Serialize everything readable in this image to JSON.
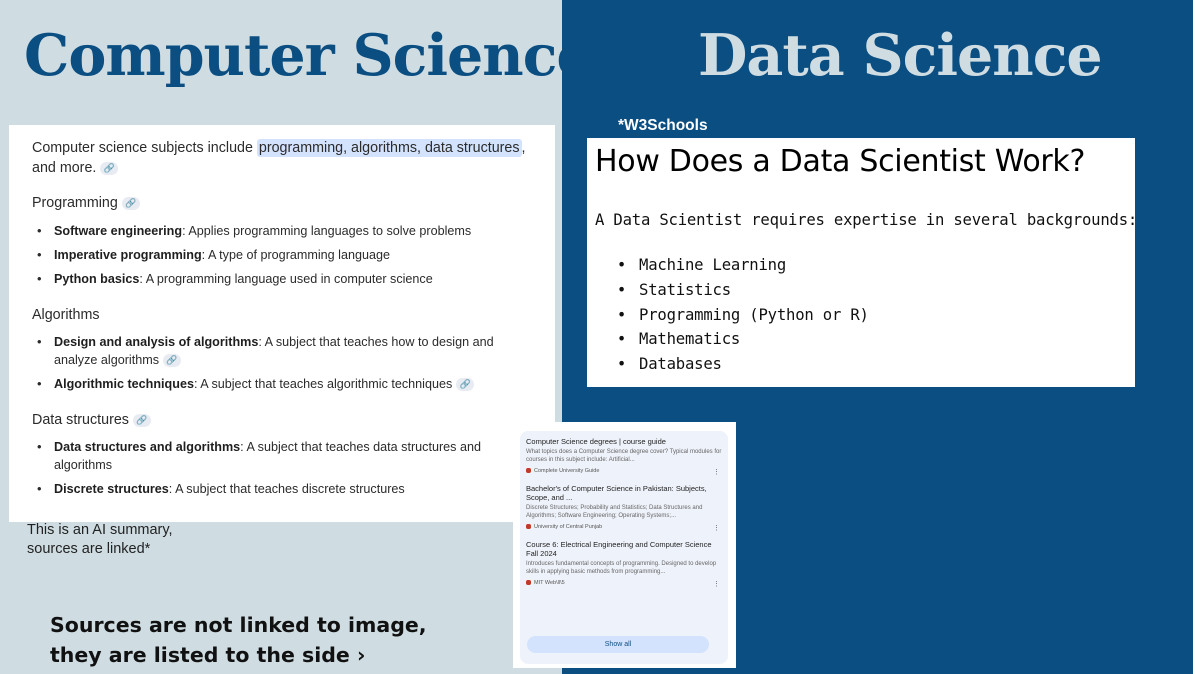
{
  "left_title": "Computer Science",
  "right_title": "Data Science",
  "ai_summary": {
    "intro_prefix": "Computer science subjects include ",
    "intro_highlight": "programming, algorithms, data structures",
    "intro_suffix": ",",
    "intro_line2": "and more.",
    "link_icon": "🔗",
    "sections": [
      {
        "heading": "Programming",
        "items": [
          {
            "term": "Software engineering",
            "desc": ": Applies programming languages to solve problems"
          },
          {
            "term": "Imperative programming",
            "desc": ": A type of programming language"
          },
          {
            "term": "Python basics",
            "desc": ": A programming language used in computer science"
          }
        ]
      },
      {
        "heading": "Algorithms",
        "items": [
          {
            "term": "Design and analysis of algorithms",
            "desc": ": A subject that teaches how to design and analyze algorithms"
          },
          {
            "term": "Algorithmic techniques",
            "desc": ": A subject that teaches algorithmic techniques"
          }
        ]
      },
      {
        "heading": "Data structures",
        "items": [
          {
            "term": "Data structures and algorithms",
            "desc": ": A subject that teaches data structures and algorithms"
          },
          {
            "term": "Discrete structures",
            "desc": ": A subject that teaches discrete structures"
          }
        ]
      }
    ]
  },
  "ai_note_line1": "This is an AI summary,",
  "ai_note_line2": "sources are linked*",
  "source_note_line1": "Sources  are not linked to image,",
  "source_note_line2": "they are listed to the side ›",
  "sources": [
    {
      "title": "Computer Science degrees | course guide",
      "desc": "What topics does a Computer Science degree cover? Typical modules for courses in this subject include: Artificial...",
      "site": "Complete University Guide"
    },
    {
      "title": "Bachelor's of Computer Science in Pakistan: Subjects, Scope, and ...",
      "desc": "Discrete Structures; Probability and Statistics; Data Structures and Algorithms; Software Engineering; Operating Systems;...",
      "site": "University of Central Punjab"
    },
    {
      "title": "Course 6: Electrical Engineering and Computer Science Fall 2024",
      "desc": "Introduces fundamental concepts of programming. Designed to develop skills in applying basic methods from programming...",
      "site": "MIT Web\\ll\\5"
    }
  ],
  "show_all_label": "Show all",
  "w3_label": "*W3Schools",
  "w3": {
    "heading": "How Does a Data Scientist Work?",
    "paragraph": "A Data Scientist requires expertise in several backgrounds:",
    "items": [
      "Machine Learning",
      "Statistics",
      "Programming (Python or R)",
      "Mathematics",
      "Databases"
    ]
  },
  "colors": {
    "dark_blue": "#0b4e82",
    "light_blue": "#cfdde3",
    "highlight": "#d3e3fd"
  }
}
